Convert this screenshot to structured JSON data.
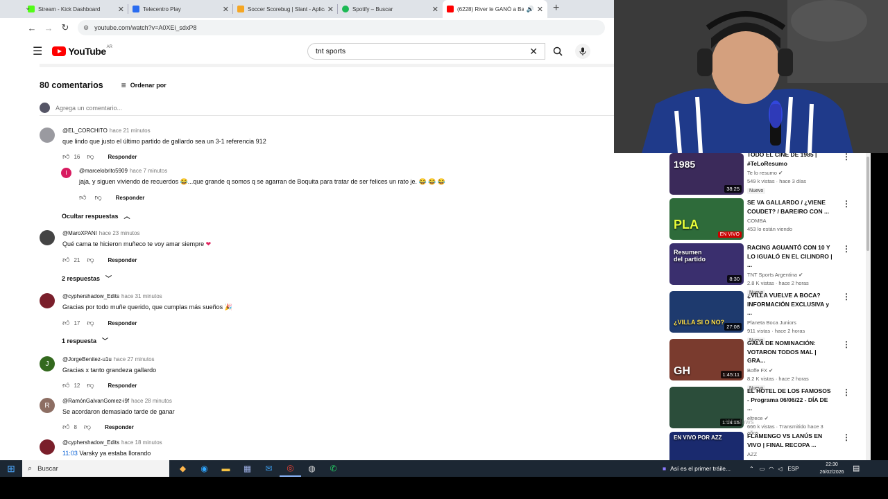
{
  "browser": {
    "tabs": [
      {
        "label": "Stream - Kick Dashboard",
        "color": "#53fc18"
      },
      {
        "label": "Telecentro Play",
        "color": "#2a6cf0"
      },
      {
        "label": "Soccer Scorebug | Slant - Aplica",
        "color": "#f5a623"
      },
      {
        "label": "Spotify – Buscar",
        "color": "#1db954"
      },
      {
        "label": "(6228) River le GANÓ a Ban",
        "color": "#ff0000"
      }
    ],
    "url": "youtube.com/watch?v=A0XEi_sdxP8"
  },
  "youtube": {
    "logo": "YouTube",
    "region": "AR",
    "search_value": "tnt sports"
  },
  "comments": {
    "count_label": "80 comentarios",
    "sort_label": "Ordenar por",
    "add_placeholder": "Agrega un comentario...",
    "reply_label": "Responder",
    "items": [
      {
        "user": "@EL_CORCHITO",
        "when": "hace 21 minutos",
        "text": "que lindo que justo el último partido de gallardo sea un 3-1 referencia 912",
        "likes": "16",
        "avatar_color": "#9a9aa0",
        "initial": ""
      },
      {
        "user": "@marcelobrito5909",
        "when": "hace 7 minutos",
        "text": "jaja, y siguen viviendo de recuerdos 😂...que grande q somos q se agarran de Boquita para tratar de ser felices un rato je. 😂 😂 😂",
        "likes": "",
        "avatar_color": "#d81b60",
        "initial": "I"
      },
      {
        "user": "@MaroXPANI",
        "when": "hace 23 minutos",
        "text": "Qué cama te hicieron muñeco te voy amar siempre",
        "likes": "21",
        "avatar_color": "#444",
        "initial": ""
      },
      {
        "user": "@cyphershadow_Edits",
        "when": "hace 31 minutos",
        "text": "Gracias por todo muñe querido, que cumplas más sueños 🎉",
        "likes": "17",
        "avatar_color": "#7a1f2b",
        "initial": ""
      },
      {
        "user": "@JorgeBenitez-u1u",
        "when": "hace 27 minutos",
        "text": "Gracias x tanto grandeza gallardo",
        "likes": "12",
        "avatar_color": "#33691e",
        "initial": "J"
      },
      {
        "user": "@RamónGalvanGomez-i9f",
        "when": "hace 28 minutos",
        "text": "Se acordaron demasiado tarde de ganar",
        "likes": "8",
        "avatar_color": "#8d6e63",
        "initial": "R"
      },
      {
        "user": "@cyphershadow_Edits",
        "when": "hace 18 minutos",
        "timestamp": "11:03",
        "text": " Varsky ya estaba llorando",
        "likes": "",
        "avatar_color": "#7a1f2b",
        "initial": ""
      }
    ],
    "hide_replies": "Ocultar respuestas",
    "replies_2": "2 respuestas",
    "replies_1": "1 respuesta"
  },
  "sidebar": {
    "videos": [
      {
        "title": "TODO EL CINE DE 1985 | #TeLoResumo",
        "channel": "Te lo resumo",
        "stats": "549 k vistas · hace 3 días",
        "badge": "Nuevo",
        "duration": "38:25",
        "thumb_text": "1985",
        "thumb_color": "#3b2a5a"
      },
      {
        "title": "SE VA GALLARDO / ¿VIENE COUDET? / BAREIRO CON ...",
        "channel": "COMBA",
        "stats": "453 lo están viendo",
        "badge": "",
        "duration": "EN VIVO",
        "thumb_text": "PLA",
        "thumb_color": "#2e6b3a"
      },
      {
        "title": "RACING AGUANTÓ CON 10 Y LO IGUALÓ EN EL CILINDRO | ...",
        "channel": "TNT Sports Argentina",
        "stats": "2.8 K vistas · hace 2 horas",
        "badge": "Nuevo",
        "duration": "8:30",
        "thumb_text": "Resumen del partido",
        "thumb_color": "#3a2f6e"
      },
      {
        "title": "¿VILLA VUELVE A BOCA? INFORMACIÓN EXCLUSIVA y ...",
        "channel": "Planeta Boca Juniors",
        "stats": "911 vistas · hace 2 horas",
        "badge": "Nuevo",
        "duration": "27:08",
        "thumb_text": "¿VILLA SI O NO?",
        "thumb_color": "#1e3a6e"
      },
      {
        "title": "GALA DE NOMINACIÓN: VOTARON TODOS MAL | GRA...",
        "channel": "Boffe FX",
        "stats": "8.2 K vistas · hace 2 horas",
        "badge": "Nuevo",
        "duration": "1:45:11",
        "thumb_text": "GH",
        "thumb_color": "#7a3b2e"
      },
      {
        "title": "EL HOTEL DE LOS FAMOSOS - Programa 06/06/22 - DÍA DE ...",
        "channel": "eltrece",
        "stats": "666 k vistas · Transmitido hace 3 años",
        "badge": "",
        "duration": "1:14:15",
        "thumb_text": "",
        "thumb_color": "#2b4d3a"
      },
      {
        "title": "FLAMENGO VS LANÚS EN VIVO | FINAL RECOPA ...",
        "channel": "AZZ",
        "stats": "",
        "badge": "",
        "duration": "",
        "thumb_text": "EN VIVO POR AZZ",
        "thumb_color": "#1a2a6e"
      }
    ]
  },
  "taskbar": {
    "search": "Buscar",
    "news": "Así es el primer tráile...",
    "lang": "ESP",
    "time": "22:30",
    "date": "26/02/2026"
  },
  "watermark": "Windows"
}
